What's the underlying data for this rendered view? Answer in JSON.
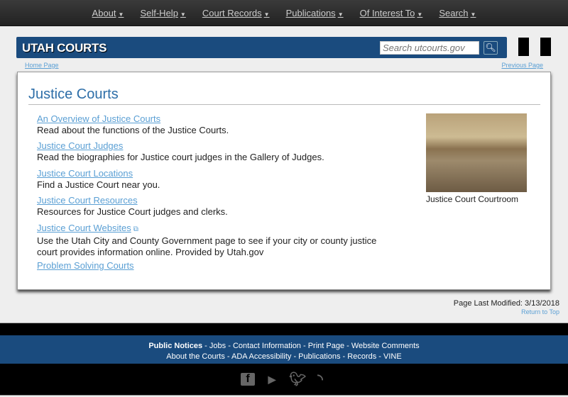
{
  "nav": [
    "About",
    "Self-Help",
    "Court Records",
    "Publications",
    "Of Interest To",
    "Search"
  ],
  "header": {
    "logo": "UTAH COURTS",
    "search_placeholder": "Search utcourts.gov"
  },
  "breadcrumbs": {
    "home": "Home Page",
    "previous": "Previous Page"
  },
  "main": {
    "title": "Justice Courts",
    "items": [
      {
        "link": "An Overview of Justice Courts",
        "desc": "Read about the functions of the Justice Courts."
      },
      {
        "link": "Justice Court Judges",
        "desc": "Read the biographies for Justice court judges in the Gallery of Judges."
      },
      {
        "link": "Justice Court Locations",
        "desc": "Find a Justice Court near you."
      },
      {
        "link": "Justice Court Resources",
        "desc": "Resources for Justice Court judges and clerks."
      },
      {
        "link": "Justice Court Websites",
        "desc": "Use the Utah City and County Government page to see if your city or county justice court provides information online. Provided by Utah.gov"
      },
      {
        "link": "Problem Solving Courts",
        "desc": ""
      }
    ],
    "image_caption": "Justice Court Courtroom"
  },
  "modified": "Page Last Modified: 3/13/2018",
  "return_top": "Return to Top",
  "footer": {
    "row1": [
      "Public Notices",
      "Jobs",
      "Contact Information",
      "Print Page",
      "Website Comments"
    ],
    "row2": [
      "About the Courts",
      "ADA Accessibility",
      "Publications",
      "Records",
      "VINE"
    ]
  }
}
